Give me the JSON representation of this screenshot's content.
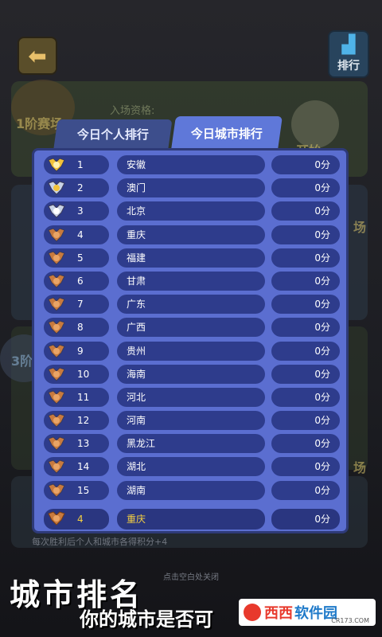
{
  "header": {
    "rank_label": "排行"
  },
  "background": {
    "entry_text": "入场资格:",
    "stage_label": "1阶赛场",
    "start_label": "开始",
    "field_label": "场",
    "stage3_label": "3阶"
  },
  "tabs": [
    {
      "label": "今日个人排行",
      "active": false
    },
    {
      "label": "今日城市排行",
      "active": true
    }
  ],
  "rows": [
    {
      "rank": "1",
      "city": "安徽",
      "score": "0分",
      "medal": "gold"
    },
    {
      "rank": "2",
      "city": "澳门",
      "score": "0分",
      "medal": "silver-gold"
    },
    {
      "rank": "3",
      "city": "北京",
      "score": "0分",
      "medal": "silver"
    },
    {
      "rank": "4",
      "city": "重庆",
      "score": "0分",
      "medal": "bronze"
    },
    {
      "rank": "5",
      "city": "福建",
      "score": "0分",
      "medal": "bronze"
    },
    {
      "rank": "6",
      "city": "甘肃",
      "score": "0分",
      "medal": "bronze"
    },
    {
      "rank": "7",
      "city": "广东",
      "score": "0分",
      "medal": "bronze"
    },
    {
      "rank": "8",
      "city": "广西",
      "score": "0分",
      "medal": "bronze"
    },
    {
      "rank": "9",
      "city": "贵州",
      "score": "0分",
      "medal": "bronze"
    },
    {
      "rank": "10",
      "city": "海南",
      "score": "0分",
      "medal": "bronze"
    },
    {
      "rank": "11",
      "city": "河北",
      "score": "0分",
      "medal": "bronze"
    },
    {
      "rank": "12",
      "city": "河南",
      "score": "0分",
      "medal": "bronze"
    },
    {
      "rank": "13",
      "city": "黑龙江",
      "score": "0分",
      "medal": "bronze"
    },
    {
      "rank": "14",
      "city": "湖北",
      "score": "0分",
      "medal": "bronze"
    },
    {
      "rank": "15",
      "city": "湖南",
      "score": "0分",
      "medal": "bronze"
    }
  ],
  "my_row": {
    "rank": "4",
    "city": "重庆",
    "score": "0分",
    "medal": "bronze"
  },
  "bottom_note": "每次胜利后个人和城市各得积分+4",
  "close_hint": "点击空白处关闭",
  "promo": {
    "title": "城市排名",
    "subtitle": "你的城市是否可"
  },
  "watermark": {
    "brand_a": "西西",
    "brand_b": "软件园",
    "url": "CR173.COM"
  },
  "colors": {
    "gold": "#f2c23a",
    "silver": "#c9d3e6",
    "bronze": "#c87a3e",
    "panel": "#5b6ed0",
    "row": "#2e3c8c",
    "highlight": "#f5d040"
  }
}
